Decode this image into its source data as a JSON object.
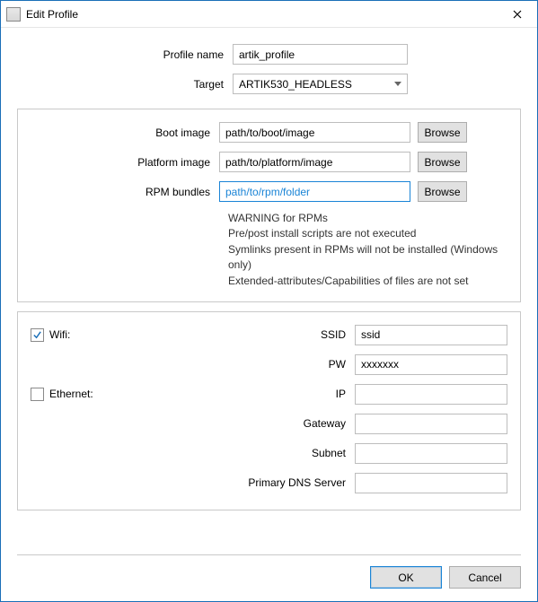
{
  "window": {
    "title": "Edit Profile"
  },
  "form": {
    "profile_name_label": "Profile name",
    "profile_name_value": "artik_profile",
    "target_label": "Target",
    "target_value": "ARTIK530_HEADLESS"
  },
  "images": {
    "boot_label": "Boot image",
    "boot_value": "path/to/boot/image",
    "platform_label": "Platform image",
    "platform_value": "path/to/platform/image",
    "rpm_label": "RPM bundles",
    "rpm_value": "path/to/rpm/folder",
    "browse_label": "Browse",
    "warning_heading": "WARNING for RPMs",
    "warning_line1": "Pre/post install scripts are not executed",
    "warning_line2": "Symlinks present in RPMs will not be installed (Windows only)",
    "warning_line3": "Extended-attributes/Capabilities of files are not set"
  },
  "network": {
    "wifi_checked": true,
    "wifi_label": "Wifi:",
    "ssid_label": "SSID",
    "ssid_value": "ssid",
    "pw_label": "PW",
    "pw_value": "xxxxxxx",
    "ethernet_checked": false,
    "ethernet_label": "Ethernet:",
    "ip_label": "IP",
    "ip_value": "",
    "gateway_label": "Gateway",
    "gateway_value": "",
    "subnet_label": "Subnet",
    "subnet_value": "",
    "dns_label": "Primary DNS Server",
    "dns_value": ""
  },
  "buttons": {
    "ok": "OK",
    "cancel": "Cancel"
  }
}
